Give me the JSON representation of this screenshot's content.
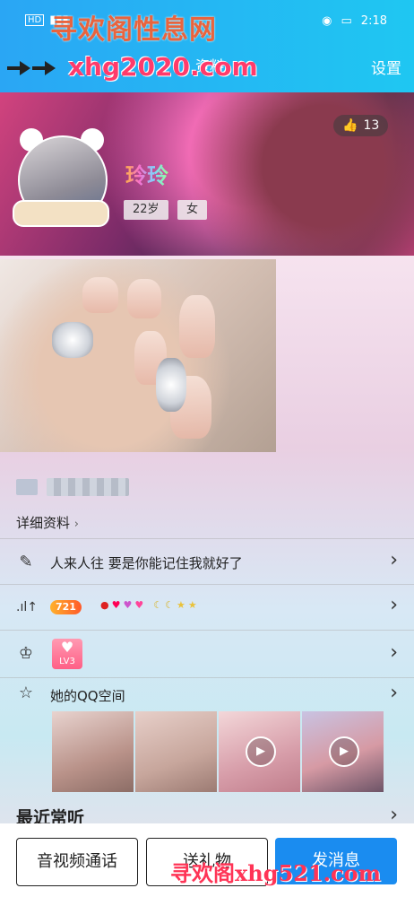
{
  "status": {
    "time": "2:18",
    "net": "HD"
  },
  "watermark_top": "寻欢阁性息网",
  "watermark_url": "xhg2020.com",
  "header": {
    "title": "资料",
    "settings": "设置"
  },
  "banner": {
    "like_count": "13",
    "name": "玲玲",
    "age": "22岁",
    "gender": "女"
  },
  "detail_label": "详细资料",
  "signature": "人来人往 要是你能记住我就好了",
  "level": {
    "points": "721",
    "lv": "LV3"
  },
  "qzone": {
    "label": "她的QQ空间"
  },
  "recent": "最近常听",
  "buttons": {
    "call": "音视频通话",
    "gift": "送礼物",
    "message": "发消息"
  },
  "watermark_bottom": "寻欢阁xhg521.com"
}
